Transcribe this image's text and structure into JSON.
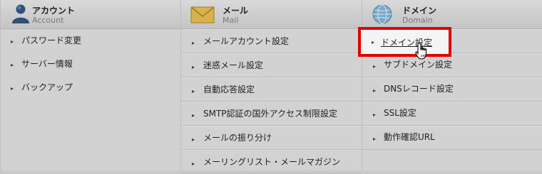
{
  "columns": [
    {
      "title": "アカウント",
      "subtitle": "Account",
      "icon": "user-icon",
      "items": [
        "パスワード変更",
        "サーバー情報",
        "バックアップ"
      ]
    },
    {
      "title": "メール",
      "subtitle": "Mail",
      "icon": "envelope-icon",
      "items": [
        "メールアカウント設定",
        "迷惑メール設定",
        "自動応答設定",
        "SMTP認証の国外アクセス制限設定",
        "メールの振り分け",
        "メーリングリスト・メールマガジン"
      ]
    },
    {
      "title": "ドメイン",
      "subtitle": "Domain",
      "icon": "globe-icon",
      "items": [
        "ドメイン設定",
        "サブドメイン設定",
        "DNSレコード設定",
        "SSL設定",
        "動作確認URL"
      ]
    }
  ],
  "highlight": {
    "label": "ドメイン設定",
    "color": "#e00000"
  },
  "colors": {
    "background": "#d2d2d2",
    "header": "#c4c4c4",
    "highlight_border": "#e00000"
  }
}
